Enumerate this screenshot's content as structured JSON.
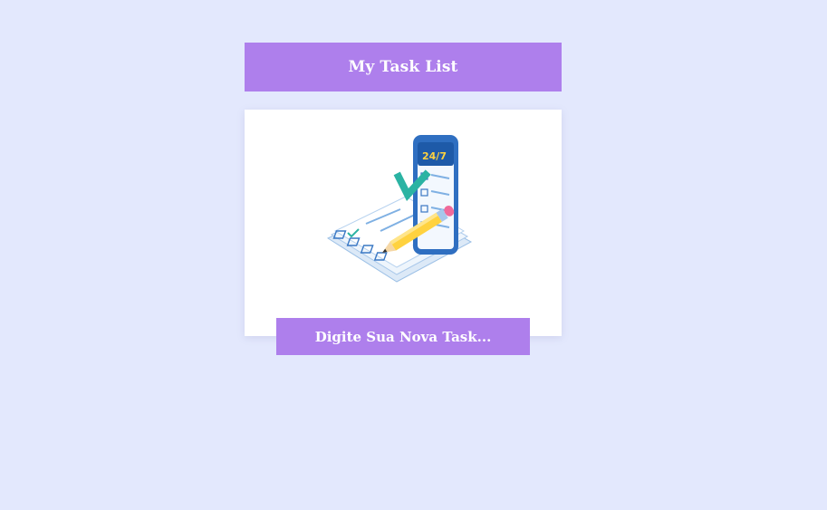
{
  "header": {
    "title": "My Task List"
  },
  "card": {
    "illustration_icon": "task-checklist-phone-illustration",
    "illustration_text": "24/7",
    "new_task_label": "Digite Sua Nova Task..."
  },
  "colors": {
    "background": "#e3e8fd",
    "accent": "#ae7fec",
    "card": "#ffffff"
  }
}
